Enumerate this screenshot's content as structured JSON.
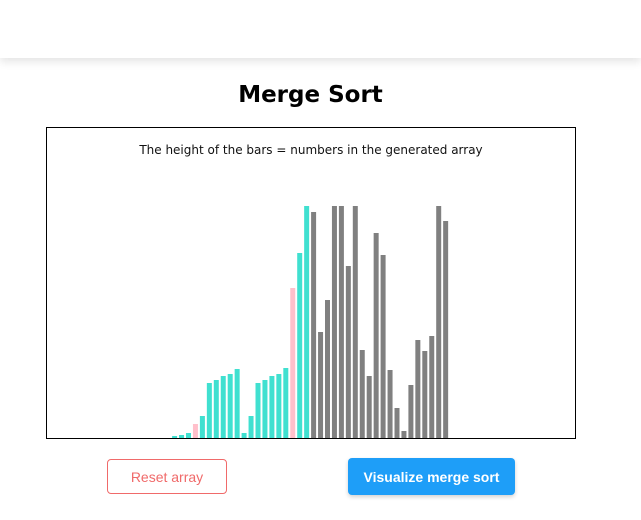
{
  "page": {
    "title": "Merge Sort"
  },
  "visualizer": {
    "caption": "The height of the bars = numbers in the generated array"
  },
  "buttons": {
    "reset_label": "Reset array",
    "visualize_label": "Visualize merge sort"
  },
  "colors": {
    "sorted": "#40e0d0",
    "comparing": "#ffc0cb",
    "unsorted": "#808080",
    "reset_accent": "#f06a6a",
    "primary": "#1e9ef8"
  },
  "chart_data": {
    "type": "bar",
    "values": [
      0,
      0,
      0,
      0,
      0,
      0,
      0,
      0,
      0,
      0,
      0,
      0,
      0,
      0,
      0,
      0,
      0,
      0,
      2,
      3,
      5,
      14,
      22,
      55,
      58,
      62,
      64,
      69,
      5,
      22,
      55,
      58,
      62,
      64,
      70,
      150,
      185,
      232,
      226,
      106,
      138,
      232,
      232,
      172,
      232,
      88,
      62,
      205,
      183,
      68,
      30,
      7,
      53,
      98,
      87,
      102,
      232,
      217
    ],
    "states": [
      "none",
      "none",
      "none",
      "none",
      "none",
      "none",
      "none",
      "none",
      "none",
      "none",
      "none",
      "none",
      "none",
      "none",
      "none",
      "none",
      "none",
      "none",
      "sorted",
      "sorted",
      "sorted",
      "comparing",
      "sorted",
      "sorted",
      "sorted",
      "sorted",
      "sorted",
      "sorted",
      "sorted",
      "sorted",
      "sorted",
      "sorted",
      "sorted",
      "sorted",
      "sorted",
      "comparing",
      "sorted",
      "sorted",
      "unsorted",
      "unsorted",
      "unsorted",
      "unsorted",
      "unsorted",
      "unsorted",
      "unsorted",
      "unsorted",
      "unsorted",
      "unsorted",
      "unsorted",
      "unsorted",
      "unsorted",
      "unsorted",
      "unsorted",
      "unsorted",
      "unsorted",
      "unsorted",
      "unsorted",
      "unsorted"
    ],
    "ylim": [
      0,
      250
    ]
  }
}
